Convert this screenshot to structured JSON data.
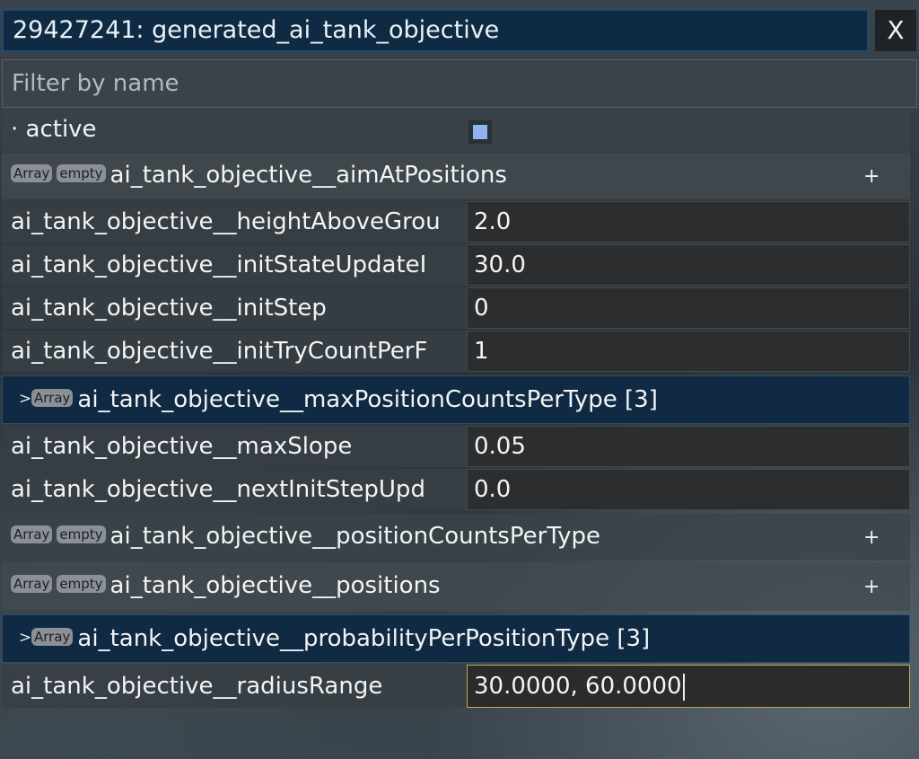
{
  "window": {
    "title": "29427241: generated_ai_tank_objective",
    "close_label": "X"
  },
  "filter": {
    "placeholder": "Filter by name",
    "value": ""
  },
  "active": {
    "label": "· active",
    "checked": true
  },
  "badges": {
    "array": "Array",
    "empty": "empty",
    "expand_arrow": ">"
  },
  "rows": {
    "aim_at_positions": {
      "name": "ai_tank_objective__aimAtPositions",
      "add": "+"
    },
    "height_above_ground": {
      "name": "ai_tank_objective__heightAboveGrou",
      "value": "2.0"
    },
    "init_state_update": {
      "name": "ai_tank_objective__initStateUpdateI",
      "value": "30.0"
    },
    "init_step": {
      "name": "ai_tank_objective__initStep",
      "value": "0"
    },
    "init_try_count": {
      "name": "ai_tank_objective__initTryCountPerF",
      "value": "1"
    },
    "max_position_counts": {
      "name": "ai_tank_objective__maxPositionCountsPerType [3]"
    },
    "max_slope": {
      "name": "ai_tank_objective__maxSlope",
      "value": "0.05"
    },
    "next_init_step": {
      "name": "ai_tank_objective__nextInitStepUpd",
      "value": "0.0"
    },
    "position_counts": {
      "name": "ai_tank_objective__positionCountsPerType",
      "add": "+"
    },
    "positions": {
      "name": "ai_tank_objective__positions",
      "add": "+"
    },
    "probability_per_type": {
      "name": "ai_tank_objective__probabilityPerPositionType [3]"
    },
    "radius_range": {
      "name": "ai_tank_objective__radiusRange",
      "value": "30.0000, 60.0000"
    }
  }
}
